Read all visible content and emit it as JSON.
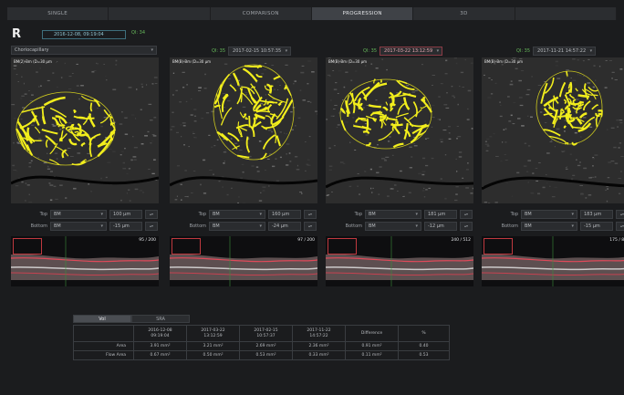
{
  "tabs": [
    {
      "label": "SINGLE",
      "state": "normal"
    },
    {
      "label": "",
      "state": "dim"
    },
    {
      "label": "COMPARISON",
      "state": "normal"
    },
    {
      "label": "PROGRESSION",
      "state": "active"
    },
    {
      "label": "3D",
      "state": "normal"
    },
    {
      "label": "",
      "state": "dim"
    }
  ],
  "header": {
    "eye": "R",
    "base_date": "2016-12-08, 09:19:04",
    "base_qi": "QI: 34",
    "layer_select": "Choriocapillary"
  },
  "panels": [
    {
      "label": "BM(2)-Bm (D=30 µm",
      "qi": "",
      "date": "",
      "date_red": false,
      "top_layer": "BM",
      "top_offset": "100 µm",
      "bottom_layer": "BM",
      "bottom_offset": "-15 µm",
      "frame": "95 / 200"
    },
    {
      "label": "BM(B)-Bm (D=30 µm",
      "qi": "QI: 35",
      "date": "2017-02-15 10:57:35",
      "date_red": false,
      "top_layer": "BM",
      "top_offset": "160 µm",
      "bottom_layer": "BM",
      "bottom_offset": "-24 µm",
      "frame": "97 / 200"
    },
    {
      "label": "BM(B)-Bm (D=30 µm",
      "qi": "QI: 35",
      "date": "2017-03-22 13:12:59",
      "date_red": true,
      "top_layer": "BM",
      "top_offset": "181 µm",
      "bottom_layer": "BM",
      "bottom_offset": "-12 µm",
      "frame": "240 / 512"
    },
    {
      "label": "BM(B)-Bm (D=30 µm",
      "qi": "QI: 35",
      "date": "2017-11-21 14:57:22",
      "date_red": false,
      "top_layer": "BM",
      "top_offset": "183 µm",
      "bottom_layer": "BM",
      "bottom_offset": "-15 µm",
      "frame": "175 / 80"
    }
  ],
  "seg_labels": {
    "top": "Top",
    "bottom": "Bottom"
  },
  "bottom_tabs": [
    {
      "label": "Vol",
      "active": true
    },
    {
      "label": "SRA",
      "active": false
    }
  ],
  "table": {
    "headers": [
      "",
      "2016-12-08\n09:19:04",
      "2017-03-22\n13:12:59",
      "2017-02-15\n10:57:37",
      "2017-11-22\n14:57:22",
      "Difference",
      "%"
    ],
    "rows": [
      {
        "label": "Area",
        "values": [
          "3.91 mm²",
          "3.21 mm²",
          "2.69 mm²",
          "2.36 mm²",
          "0.91 mm²",
          "0.40"
        ]
      },
      {
        "label": "Flow Area",
        "values": [
          "0.67 mm²",
          "0.50 mm²",
          "0.53 mm²",
          "0.33 mm²",
          "0.11 mm²",
          "0.53"
        ]
      }
    ]
  },
  "colors": {
    "overlay": "#f2ee1c",
    "accent_red": "#c0393f",
    "qi_green": "#66b85a"
  }
}
